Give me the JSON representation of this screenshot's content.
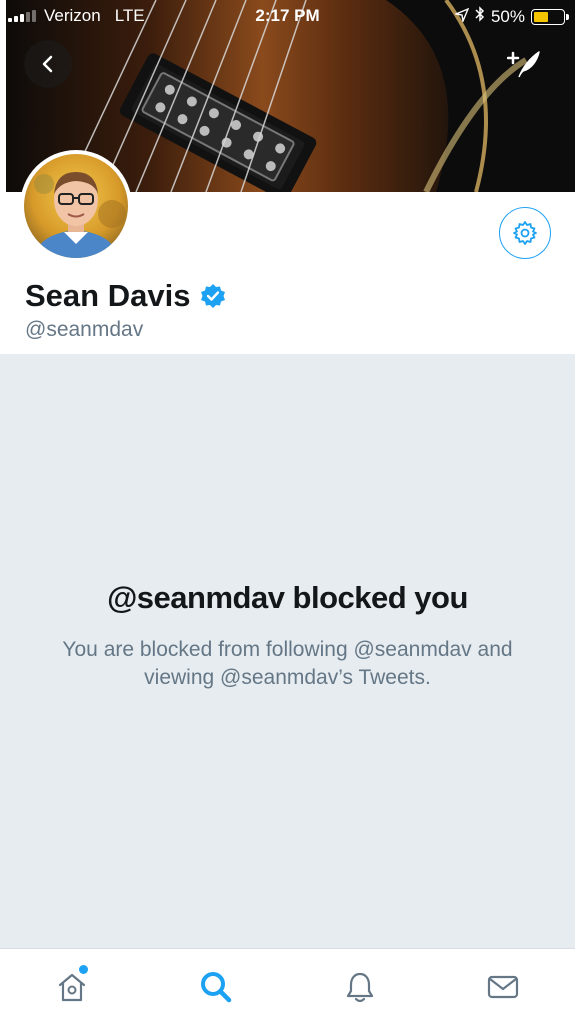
{
  "status_bar": {
    "carrier": "Verizon",
    "network": "LTE",
    "time": "2:17 PM",
    "battery_percent": "50%",
    "battery_level": 0.5,
    "battery_color": "#f5c400"
  },
  "header": {
    "back_icon": "chevron-left-icon",
    "compose_icon": "compose-tweet-icon"
  },
  "profile": {
    "name": "Sean Davis",
    "handle": "@seanmdav",
    "verified": true,
    "settings_icon": "gear-icon"
  },
  "blocked": {
    "title": "@seanmdav blocked you",
    "description": "You are blocked from following @seanmdav and viewing @seanmdav’s Tweets."
  },
  "tabbar": {
    "items": [
      {
        "icon": "home-icon",
        "active": false,
        "has_dot": true
      },
      {
        "icon": "search-icon",
        "active": true
      },
      {
        "icon": "bell-icon",
        "active": false
      },
      {
        "icon": "envelope-icon",
        "active": false
      }
    ]
  },
  "colors": {
    "accent": "#1da1f2",
    "background_gray": "#e6ecf0",
    "text_primary": "#14171a",
    "text_secondary": "#657786"
  }
}
